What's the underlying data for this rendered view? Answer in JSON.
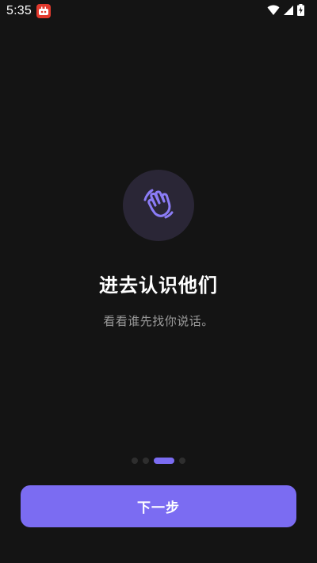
{
  "status_bar": {
    "time": "5:35",
    "icons": [
      "app-notification-icon",
      "wifi-icon",
      "signal-icon",
      "battery-charging-icon"
    ]
  },
  "onboarding": {
    "icon": "waving-hand-icon",
    "title": "进去认识他们",
    "subtitle": "看看谁先找你说话。",
    "pager": {
      "total": 4,
      "active_index": 2
    },
    "next_button_label": "下一步"
  },
  "colors": {
    "background": "#141414",
    "accent": "#7b6cf2",
    "icon_circle": "#2a2636",
    "subtitle_text": "#9a9a9a",
    "inactive_dot": "#2e2e2e"
  }
}
